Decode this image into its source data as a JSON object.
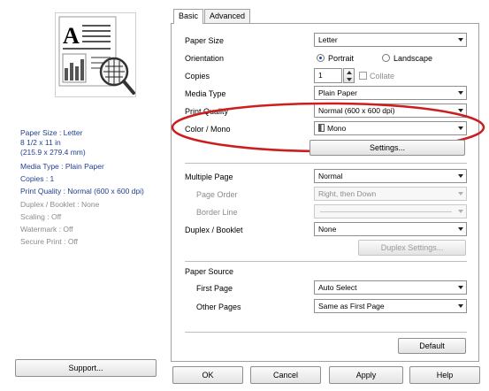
{
  "tabs": {
    "basic": "Basic",
    "advanced": "Advanced"
  },
  "preview": {
    "glyph": "A"
  },
  "summary": {
    "paper_size": "Paper Size : Letter",
    "paper_dims_1": "8 1/2 x 11 in",
    "paper_dims_2": "(215.9 x 279.4 mm)",
    "media_type": "Media Type : Plain Paper",
    "copies": "Copies : 1",
    "print_quality": "Print Quality : Normal (600 x 600 dpi)",
    "duplex": "Duplex / Booklet : None",
    "scaling": "Scaling : Off",
    "watermark": "Watermark : Off",
    "secure_print": "Secure Print : Off"
  },
  "form": {
    "paper_size": {
      "label": "Paper Size",
      "value": "Letter"
    },
    "orientation": {
      "label": "Orientation",
      "portrait": "Portrait",
      "landscape": "Landscape",
      "selected": "Portrait"
    },
    "copies": {
      "label": "Copies",
      "value": "1",
      "collate": "Collate"
    },
    "media_type": {
      "label": "Media Type",
      "value": "Plain Paper"
    },
    "print_quality": {
      "label": "Print Quality",
      "value": "Normal (600 x 600 dpi)"
    },
    "color_mono": {
      "label": "Color / Mono",
      "value": "Mono"
    },
    "settings_button": "Settings...",
    "multiple_page": {
      "label": "Multiple Page",
      "value": "Normal"
    },
    "page_order": {
      "label": "Page Order",
      "value": "Right, then Down"
    },
    "border_line": {
      "label": "Border Line"
    },
    "duplex_booklet": {
      "label": "Duplex / Booklet",
      "value": "None"
    },
    "duplex_settings_button": "Duplex Settings...",
    "paper_source": {
      "label": "Paper Source"
    },
    "first_page": {
      "label": "First Page",
      "value": "Auto Select"
    },
    "other_pages": {
      "label": "Other Pages",
      "value": "Same as First Page"
    },
    "default_button": "Default"
  },
  "buttons": {
    "support": "Support...",
    "ok": "OK",
    "cancel": "Cancel",
    "apply": "Apply",
    "help": "Help"
  },
  "colors": {
    "summary_active": "#1f3f8f",
    "annotation": "#cc1e1e"
  }
}
